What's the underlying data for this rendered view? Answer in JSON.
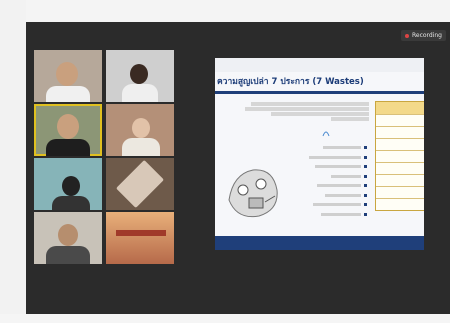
{
  "recording_badge": {
    "label": "Recording"
  },
  "slide": {
    "title": "ความสูญเปล่า 7 ประการ (7 Wastes)"
  },
  "participants": [
    {
      "name": ""
    },
    {
      "name": ""
    },
    {
      "name": ""
    },
    {
      "name": ""
    },
    {
      "name": ""
    },
    {
      "name": ""
    },
    {
      "name": ""
    },
    {
      "name": ""
    }
  ],
  "colors": {
    "meeting_bg": "#2b2b2b",
    "slide_accent": "#1f3f7a",
    "active_speaker": "#e0c020"
  }
}
